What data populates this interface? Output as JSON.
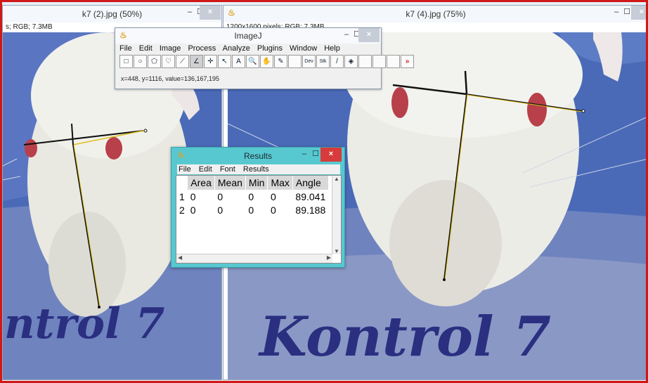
{
  "left_window": {
    "title": "k7 (2).jpg (50%)",
    "info": "s; RGB; 7.3MB",
    "min": "–",
    "max": "☐",
    "close": "×"
  },
  "right_window": {
    "title": "k7 (4).jpg (75%)",
    "info": "1200x1600 pixels; RGB; 7.3MB",
    "min": "–",
    "max": "☐",
    "close": "×"
  },
  "imagej": {
    "title": "ImageJ",
    "menu": [
      "File",
      "Edit",
      "Image",
      "Process",
      "Analyze",
      "Plugins",
      "Window",
      "Help"
    ],
    "tools": [
      {
        "name": "rectangle-tool-icon",
        "glyph": "□"
      },
      {
        "name": "oval-tool-icon",
        "glyph": "○"
      },
      {
        "name": "polygon-tool-icon",
        "glyph": "⬠"
      },
      {
        "name": "freehand-tool-icon",
        "glyph": "♡"
      },
      {
        "name": "line-tool-icon",
        "glyph": "⟋"
      },
      {
        "name": "angle-tool-icon",
        "glyph": "∠"
      },
      {
        "name": "point-tool-icon",
        "glyph": "✛"
      },
      {
        "name": "wand-tool-icon",
        "glyph": "↖"
      },
      {
        "name": "text-tool-icon",
        "glyph": "A"
      },
      {
        "name": "magnifier-tool-icon",
        "glyph": "🔍"
      },
      {
        "name": "scroll-tool-icon",
        "glyph": "✋"
      },
      {
        "name": "color-picker-tool-icon",
        "glyph": "✎"
      },
      {
        "name": "blank-tool-slot",
        "glyph": ""
      },
      {
        "name": "dev-tool-icon",
        "glyph": "Dev"
      },
      {
        "name": "stk-tool-icon",
        "glyph": "Stk"
      },
      {
        "name": "brush-tool-icon",
        "glyph": "/"
      },
      {
        "name": "flood-fill-tool-icon",
        "glyph": "◈"
      },
      {
        "name": "blank-tool-slot",
        "glyph": ""
      },
      {
        "name": "blank-tool-slot",
        "glyph": ""
      },
      {
        "name": "blank-tool-slot",
        "glyph": ""
      },
      {
        "name": "more-tools-icon",
        "glyph": "»"
      }
    ],
    "status": "x=448, y=1116, value=136,167,195"
  },
  "results": {
    "title": "Results",
    "menu": [
      "File",
      "Edit",
      "Font",
      "Results"
    ],
    "columns": [
      "",
      "Area",
      "Mean",
      "Min",
      "Max",
      "Angle"
    ],
    "rows": [
      [
        "1",
        "0",
        "0",
        "0",
        "0",
        "89.041"
      ],
      [
        "2",
        "0",
        "0",
        "0",
        "0",
        "89.188"
      ]
    ]
  },
  "handwriting": {
    "left": "ntrol 7",
    "right": "Kontrol 7"
  },
  "colors": {
    "frame": "#d01818",
    "results_title": "#58c8d0",
    "fur_blue": "#3b5da8",
    "angle_line": "#e0c020"
  }
}
